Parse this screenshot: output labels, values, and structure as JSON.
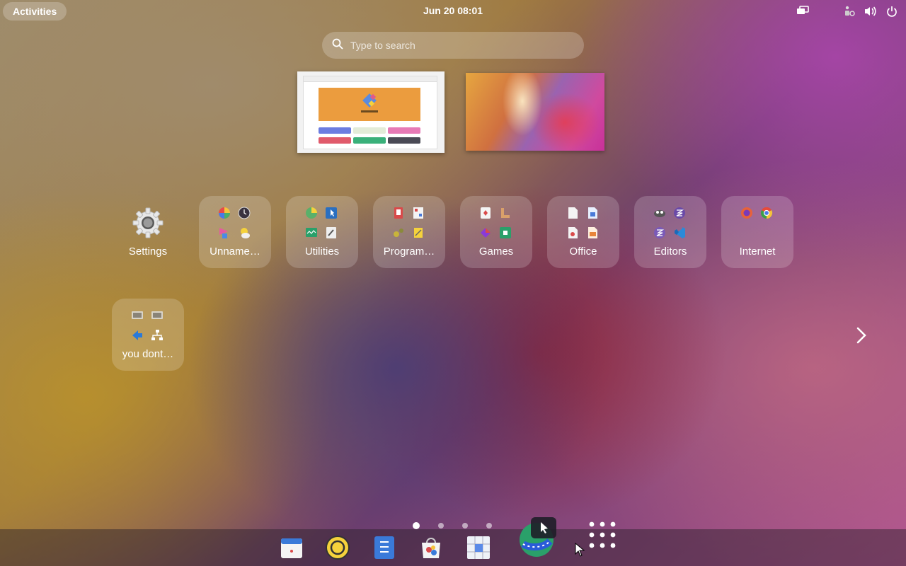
{
  "topbar": {
    "activities_label": "Activities",
    "clock": "Jun 20  08:01",
    "tray_icons": [
      "screen-share-icon",
      "accessibility-icon",
      "volume-icon",
      "power-icon"
    ]
  },
  "search": {
    "placeholder": "Type to search"
  },
  "workspaces": [
    {
      "name": "workspace-1"
    },
    {
      "name": "workspace-2"
    }
  ],
  "apps": [
    {
      "label": "Settings",
      "kind": "app"
    },
    {
      "label": "Unname…",
      "kind": "folder"
    },
    {
      "label": "Utilities",
      "kind": "folder"
    },
    {
      "label": "Program…",
      "kind": "folder"
    },
    {
      "label": "Games",
      "kind": "folder"
    },
    {
      "label": "Office",
      "kind": "folder"
    },
    {
      "label": "Editors",
      "kind": "folder"
    },
    {
      "label": "Internet",
      "kind": "folder"
    },
    {
      "label": "you dont…",
      "kind": "folder"
    }
  ],
  "pagination": {
    "pages": 4,
    "current": 1
  },
  "dock": [
    "calendar-icon",
    "rhythmbox-icon",
    "text-editor-icon",
    "software-store-icon",
    "sudoku-icon",
    "globe-app-icon",
    "show-apps-icon"
  ],
  "colors": {
    "accent": "#ffffff",
    "folder_bg": "rgba(255,255,255,0.18)"
  }
}
